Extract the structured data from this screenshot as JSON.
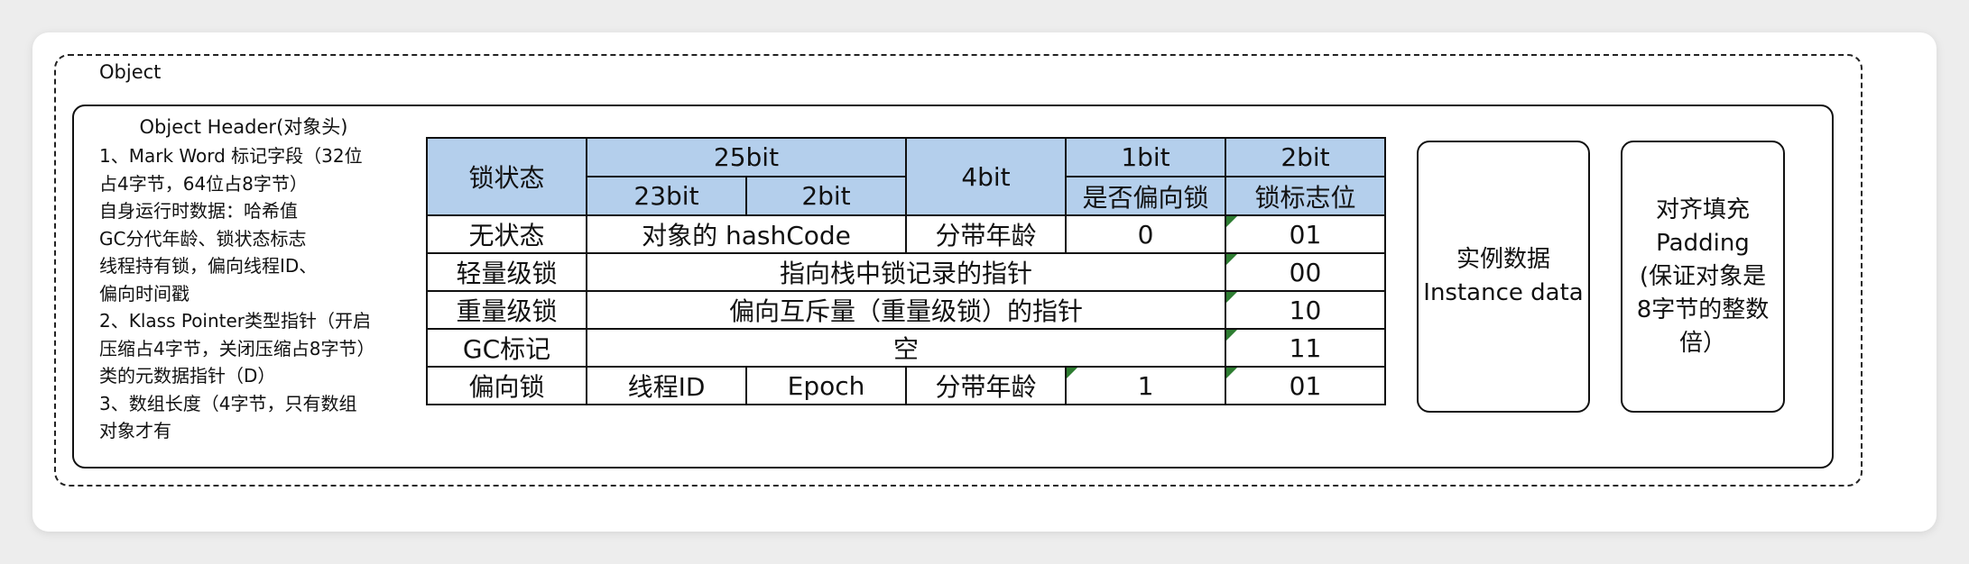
{
  "object_label": "Object",
  "header": {
    "title": "Object Header(对象头)",
    "lines": [
      "1、Mark Word 标记字段（32位",
      "占4字节，64位占8字节）",
      "自身运行时数据：哈希值",
      "GC分代年龄、锁状态标志",
      "线程持有锁，偏向线程ID、",
      "偏向时间戳",
      "2、Klass Pointer类型指针（开启",
      "压缩占4字节，关闭压缩占8字节）",
      "类的元数据指针（D）",
      "3、数组长度（4字节，只有数组",
      "对象才有"
    ]
  },
  "table": {
    "lock_state_header": "锁状态",
    "bits_25": "25bit",
    "bits_23": "23bit",
    "bits_2": "2bit",
    "bits_4": "4bit",
    "bits_1": "1bit",
    "bits_2_flag": "2bit",
    "biased_header": "是否偏向锁",
    "flag_header": "锁标志位",
    "rows": {
      "no_lock": {
        "state": "无状态",
        "hash": "对象的 hashCode",
        "age": "分带年龄",
        "biased": "0",
        "flag": "01"
      },
      "light": {
        "state": "轻量级锁",
        "content": "指向栈中锁记录的指针",
        "flag": "00"
      },
      "heavy": {
        "state": "重量级锁",
        "content": "偏向互斥量（重量级锁）的指针",
        "flag": "10"
      },
      "gc": {
        "state": "GC标记",
        "content": "空",
        "flag": "11"
      },
      "biased": {
        "state": "偏向锁",
        "thread": "线程ID",
        "epoch": "Epoch",
        "age": "分带年龄",
        "biased": "1",
        "flag": "01"
      }
    }
  },
  "instance": {
    "line1": "实例数据",
    "line2": "Instance data"
  },
  "padding": {
    "lines": [
      "对齐填充",
      "Padding",
      "(保证对象是",
      "8字节的整数",
      "倍）"
    ]
  },
  "colors": {
    "header_fill": "#b4cfec",
    "marker": "#2e7d32"
  }
}
